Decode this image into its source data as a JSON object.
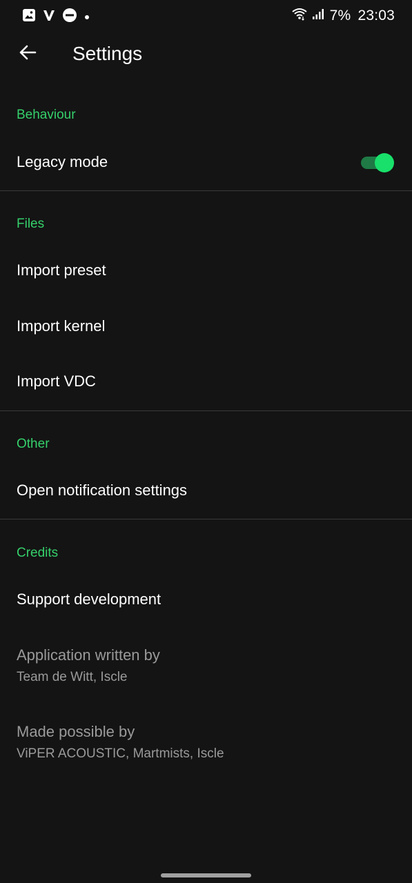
{
  "status_bar": {
    "battery": "7%",
    "time": "23:03",
    "icons": [
      "image-icon",
      "v-app-icon",
      "do-not-disturb-icon",
      "dot-icon",
      "wifi-icon",
      "signal-icon"
    ]
  },
  "app_bar": {
    "title": "Settings",
    "back_icon": "arrow-back-icon"
  },
  "sections": {
    "behaviour": {
      "header": "Behaviour",
      "legacy_mode": {
        "label": "Legacy mode",
        "enabled": true
      }
    },
    "files": {
      "header": "Files",
      "import_preset": "Import preset",
      "import_kernel": "Import kernel",
      "import_vdc": "Import VDC"
    },
    "other": {
      "header": "Other",
      "open_notification_settings": "Open notification settings"
    },
    "credits": {
      "header": "Credits",
      "support_development": "Support development",
      "application_written_by": {
        "title": "Application written by",
        "summary": "Team de Witt, Iscle"
      },
      "made_possible_by": {
        "title": "Made possible by",
        "summary": "ViPER ACOUSTIC, Martmists, Iscle"
      }
    }
  },
  "colors": {
    "background": "#141414",
    "accent": "#35d06b",
    "switch_thumb": "#18e06a",
    "switch_track": "#1f7a45",
    "secondary_text": "#9a9a9a",
    "divider": "#3a3a3a"
  }
}
